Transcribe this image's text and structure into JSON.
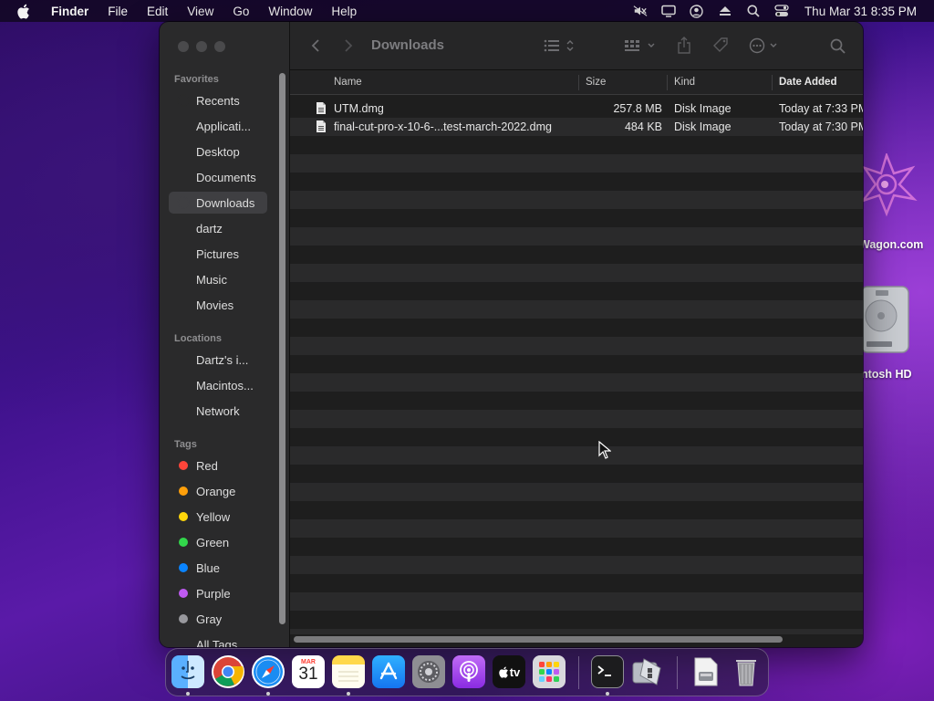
{
  "menubar": {
    "app_name": "Finder",
    "menus": [
      "File",
      "Edit",
      "View",
      "Go",
      "Window",
      "Help"
    ],
    "clock": "Thu Mar 31  8:35 PM",
    "status_icons": [
      "mute-icon",
      "display-icon",
      "user-icon",
      "eject-icon",
      "search-icon",
      "control-center-icon"
    ]
  },
  "desktop": {
    "items": [
      {
        "label": "Wagon.com",
        "icon": "logo-icon"
      },
      {
        "label": "ntosh HD",
        "icon": "hard-drive-icon"
      }
    ]
  },
  "window": {
    "title": "Downloads",
    "sidebar": {
      "favorites_title": "Favorites",
      "favorites": [
        {
          "label": "Recents",
          "icon": "clock-icon"
        },
        {
          "label": "Applicati...",
          "icon": "applications-icon"
        },
        {
          "label": "Desktop",
          "icon": "desktop-icon"
        },
        {
          "label": "Documents",
          "icon": "document-icon"
        },
        {
          "label": "Downloads",
          "icon": "download-icon",
          "selected": true
        },
        {
          "label": "dartz",
          "icon": "home-icon"
        },
        {
          "label": "Pictures",
          "icon": "photo-icon"
        },
        {
          "label": "Music",
          "icon": "music-icon"
        },
        {
          "label": "Movies",
          "icon": "film-icon"
        }
      ],
      "locations_title": "Locations",
      "locations": [
        {
          "label": "Dartz's i...",
          "icon": "laptop-icon"
        },
        {
          "label": "Macintos...",
          "icon": "disk-icon"
        },
        {
          "label": "Network",
          "icon": "network-icon"
        }
      ],
      "tags_title": "Tags",
      "tags": [
        {
          "label": "Red",
          "color": "#ff453a"
        },
        {
          "label": "Orange",
          "color": "#ff9f0a"
        },
        {
          "label": "Yellow",
          "color": "#ffd60a"
        },
        {
          "label": "Green",
          "color": "#32d74b"
        },
        {
          "label": "Blue",
          "color": "#0a84ff"
        },
        {
          "label": "Purple",
          "color": "#bf5af2"
        },
        {
          "label": "Gray",
          "color": "#98989d"
        },
        {
          "label": "All Tags...",
          "color": ""
        }
      ]
    },
    "columns": {
      "name": "Name",
      "size": "Size",
      "kind": "Kind",
      "date": "Date Added"
    },
    "files": [
      {
        "name": "UTM.dmg",
        "size": "257.8 MB",
        "kind": "Disk Image",
        "date": "Today at 7:33 PM"
      },
      {
        "name": "final-cut-pro-x-10-6-...test-march-2022.dmg",
        "size": "484 KB",
        "kind": "Disk Image",
        "date": "Today at 7:30 PM"
      }
    ]
  },
  "dock": {
    "apps": [
      "Finder",
      "Chrome",
      "Safari",
      "Calendar",
      "Notes",
      "App Store",
      "System Preferences",
      "Podcasts",
      "Apple TV",
      "Launchpad",
      "Terminal",
      "Boot Camp Assistant",
      "Downloads",
      "Trash"
    ],
    "calendar": {
      "month": "MAR",
      "day": "31"
    },
    "tv_label": "tv"
  }
}
